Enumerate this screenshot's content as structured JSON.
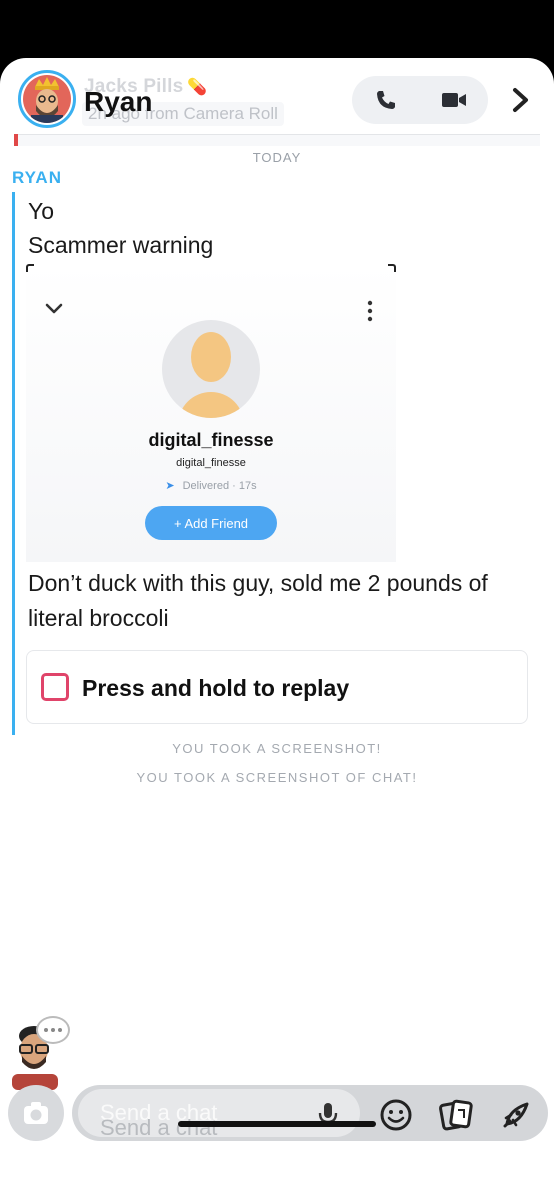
{
  "header": {
    "story_title": "Jacks Pills",
    "pill_emoji": "💊",
    "contact_name": "Ryan",
    "story_subtitle": "2h ago from Camera Roll"
  },
  "chat": {
    "date_separator": "TODAY",
    "sender": "RYAN",
    "messages": {
      "yo": "Yo",
      "warning": "Scammer warning",
      "duck": "Don’t duck with this guy, sold me 2 pounds of literal broccoli"
    },
    "screenshot_card": {
      "name": "digital_finesse",
      "username": "digital_finesse",
      "delivered": "Delivered · 17s",
      "add_friend": "+ Add Friend"
    },
    "replay_label": "Press and hold to replay",
    "notices": [
      "YOU TOOK A SCREENSHOT!",
      "YOU TOOK A SCREENSHOT OF CHAT!"
    ]
  },
  "composer": {
    "placeholder": "Send a chat",
    "ghost": "Send a chat"
  },
  "colors": {
    "accent_blue": "#3ab0f0",
    "replay_red": "#e0446a",
    "add_friend_blue": "#4da6f2"
  }
}
